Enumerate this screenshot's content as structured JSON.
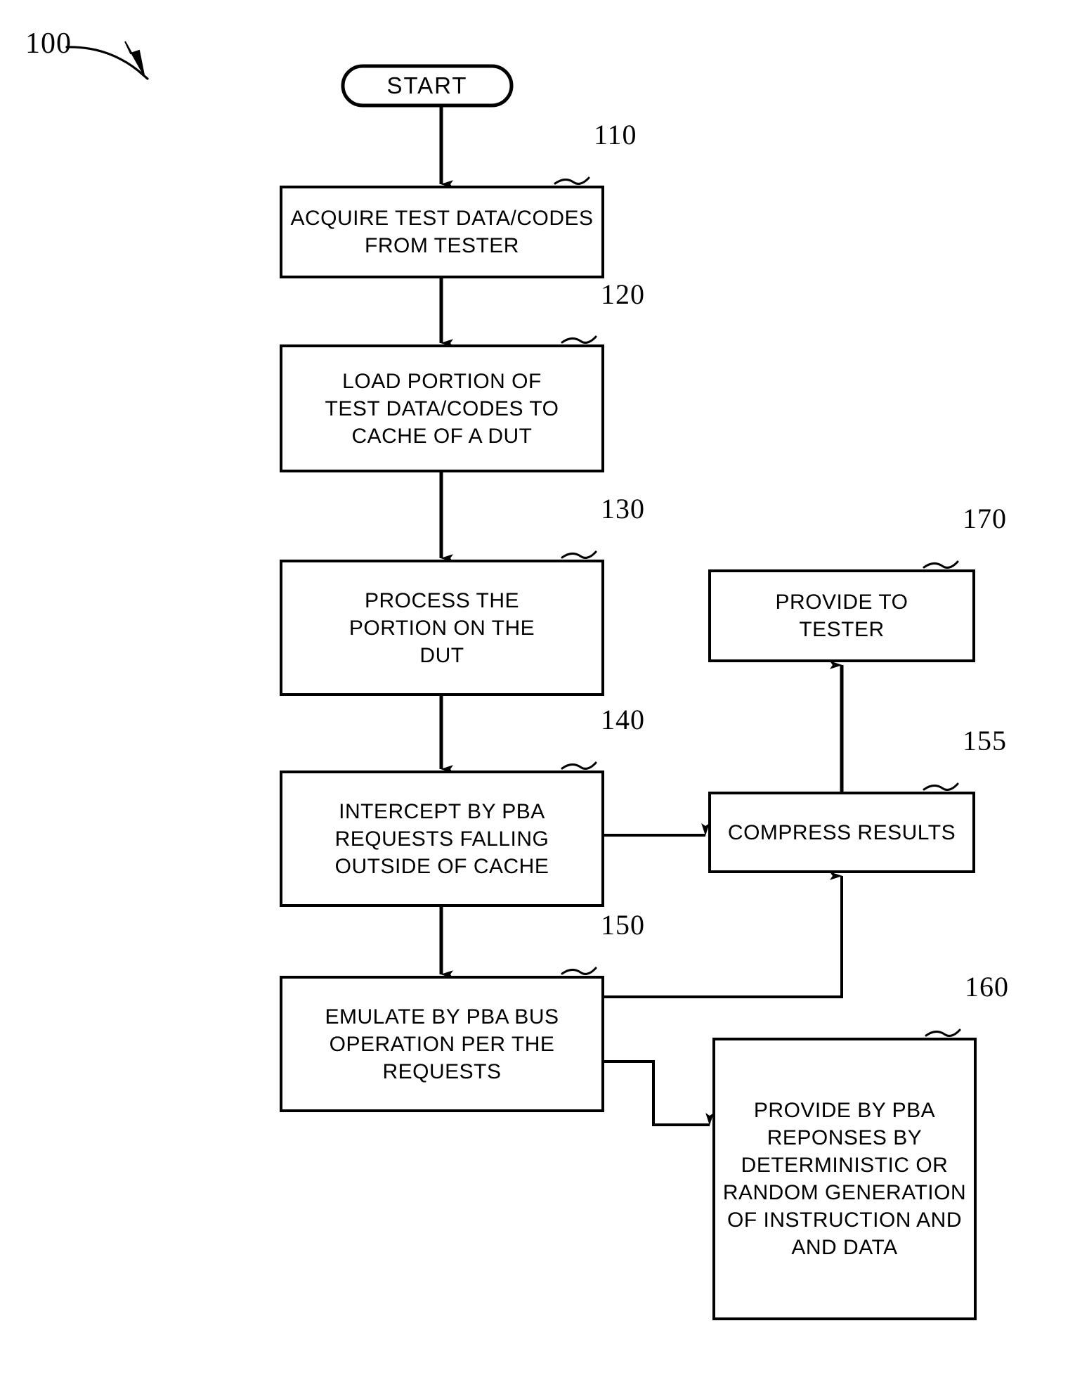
{
  "figure": {
    "number": "100",
    "style": {
      "stroke": "#000000",
      "background": "#ffffff"
    }
  },
  "nodes": [
    {
      "id": "start",
      "shape": "terminal",
      "lines": [
        "START"
      ],
      "ref": null
    },
    {
      "id": "acquire",
      "shape": "process",
      "lines": [
        "ACQUIRE TEST DATA/CODES",
        "FROM TESTER"
      ],
      "ref": "110"
    },
    {
      "id": "load",
      "shape": "process",
      "lines": [
        "LOAD PORTION OF",
        "TEST DATA/CODES TO",
        "CACHE OF A DUT"
      ],
      "ref": "120"
    },
    {
      "id": "process",
      "shape": "process",
      "lines": [
        "PROCESS THE",
        "PORTION ON THE",
        "DUT"
      ],
      "ref": "130"
    },
    {
      "id": "intercept",
      "shape": "process",
      "lines": [
        "INTERCEPT BY PBA",
        "REQUESTS FALLING",
        "OUTSIDE OF CACHE"
      ],
      "ref": "140"
    },
    {
      "id": "emulate",
      "shape": "process",
      "lines": [
        "EMULATE BY PBA BUS",
        "OPERATION PER THE",
        "REQUESTS"
      ],
      "ref": "150"
    },
    {
      "id": "provide-tester",
      "shape": "process",
      "lines": [
        "PROVIDE TO",
        "TESTER"
      ],
      "ref": "170"
    },
    {
      "id": "compress",
      "shape": "process",
      "lines": [
        "COMPRESS RESULTS"
      ],
      "ref": "155"
    },
    {
      "id": "provide-pba",
      "shape": "process",
      "lines": [
        "PROVIDE BY PBA",
        "REPONSES BY",
        "DETERMINISTIC OR",
        "RANDOM GENERATION",
        "OF INSTRUCTION AND",
        "AND DATA"
      ],
      "ref": "160"
    }
  ],
  "edges": [
    {
      "from": "start",
      "to": "acquire",
      "kind": "vertical-arrow"
    },
    {
      "from": "acquire",
      "to": "load",
      "kind": "vertical-arrow"
    },
    {
      "from": "load",
      "to": "process",
      "kind": "vertical-arrow"
    },
    {
      "from": "process",
      "to": "intercept",
      "kind": "vertical-arrow"
    },
    {
      "from": "intercept",
      "to": "emulate",
      "kind": "vertical-arrow"
    },
    {
      "from": "intercept",
      "to": "compress",
      "kind": "horizontal-arrow"
    },
    {
      "from": "emulate",
      "to": "compress",
      "kind": "elbow-arrow-up"
    },
    {
      "from": "emulate",
      "to": "provide-pba",
      "kind": "elbow-arrow-right"
    },
    {
      "from": "compress",
      "to": "provide-tester",
      "kind": "vertical-arrow-up"
    }
  ]
}
